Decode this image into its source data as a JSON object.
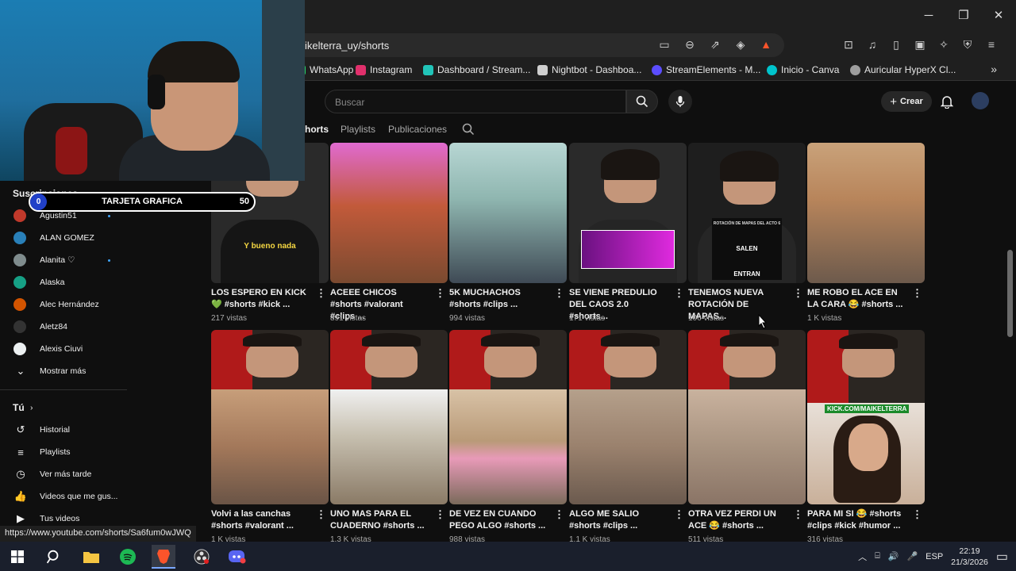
{
  "browser": {
    "url": "ikelterra_uy/shorts",
    "bookmarks": [
      {
        "label": "WhatsApp",
        "color": "#25d366"
      },
      {
        "label": "Instagram",
        "color": "#e1306c"
      },
      {
        "label": "Dashboard / Stream...",
        "color": "#21c4b8"
      },
      {
        "label": "Nightbot - Dashboa...",
        "color": "#cfcfcf"
      },
      {
        "label": "StreamElements - M...",
        "color": "#5b4dff"
      },
      {
        "label": "Inicio - Canva",
        "color": "#00c4cc"
      },
      {
        "label": "Auricular HyperX Cl...",
        "color": "#9e9e9e"
      }
    ],
    "status_url": "https://www.youtube.com/shorts/Sa6fum0wJWQ"
  },
  "youtube": {
    "search_placeholder": "Buscar",
    "create_label": "Crear",
    "tabs": [
      "Shorts",
      "Playlists",
      "Publicaciones"
    ],
    "tabs_display": [
      "horts",
      "Playlists",
      "Publicaciones"
    ],
    "active_tab": "Shorts"
  },
  "overlay": {
    "goal_label": "TARJETA GRAFICA",
    "goal_min": "0",
    "goal_max": "50",
    "goal_progress": 0.0
  },
  "sidebar": {
    "subscriptions_header": "Suscripciones",
    "subscriptions": [
      {
        "label": "Agustin51",
        "color": "#c0392b",
        "new": true
      },
      {
        "label": "ALAN GOMEZ",
        "color": "#2980b9",
        "new": false
      },
      {
        "label": "Alanita ♡",
        "color": "#7f8c8d",
        "new": true
      },
      {
        "label": "Alaska",
        "color": "#16a085",
        "new": false
      },
      {
        "label": "Alec Hernández",
        "color": "#d35400",
        "new": false
      },
      {
        "label": "Aletz84",
        "color": "#333333",
        "new": false
      },
      {
        "label": "Alexis Ciuvi",
        "color": "#ecf0f1",
        "new": false
      }
    ],
    "show_more": "Mostrar más",
    "you_header": "Tú",
    "you_items": [
      {
        "label": "Historial",
        "icon": "history-icon",
        "glyph": "↺"
      },
      {
        "label": "Playlists",
        "icon": "playlists-icon",
        "glyph": "≡"
      },
      {
        "label": "Ver más tarde",
        "icon": "watch-later-icon",
        "glyph": "◷"
      },
      {
        "label": "Videos que me gus...",
        "icon": "thumbs-up-icon",
        "glyph": "👍"
      },
      {
        "label": "Tus videos",
        "icon": "your-videos-icon",
        "glyph": "▶"
      }
    ]
  },
  "shorts_row1": [
    {
      "title": "LOS ESPERO EN KICK 💚 #shorts #kick ...",
      "views": "217 vistas"
    },
    {
      "title": "ACEEE CHICOS #shorts #valorant #clips ...",
      "views": "891 vistas"
    },
    {
      "title": "5K MUCHACHOS #shorts #clips ...",
      "views": "994 vistas"
    },
    {
      "title": "SE VIENE PREDULIO DEL CAOS 2.0 #shorts...",
      "views": "171 vistas"
    },
    {
      "title": "TENEMOS NUEVA ROTACIÓN DE MAPAS...",
      "views": "106 vistas"
    },
    {
      "title": "ME ROBO EL ACE EN LA CARA 😂 #shorts ...",
      "views": "1 K vistas"
    }
  ],
  "shorts_row2": [
    {
      "title": "Volvi a las canchas #shorts #valorant ...",
      "views": "1 K vistas"
    },
    {
      "title": "UNO MAS PARA EL CUADERNO #shorts ...",
      "views": "1,3 K vistas"
    },
    {
      "title": "DE VEZ EN CUANDO PEGO ALGO #shorts ...",
      "views": "988 vistas"
    },
    {
      "title": "ALGO ME SALIO #shorts #clips ...",
      "views": "1,1 K vistas"
    },
    {
      "title": "OTRA VEZ PERDI UN ACE 😂 #shorts ...",
      "views": "511 vistas"
    },
    {
      "title": "PARA MI SI 😂 #shorts #clips #kick #humor ...",
      "views": "316 vistas"
    }
  ],
  "thumb_texts": {
    "row1_0": "Y bueno nada",
    "row1_4_top": "ROTACIÓN DE MAPAS DEL ACTO 6",
    "row1_4_a": "SALEN",
    "row1_4_b": "ENTRAN",
    "row2_5": "KICK.COM/MAIKELTERRA"
  },
  "taskbar": {
    "language": "ESP",
    "time": "22:19",
    "date": "21/3/2026"
  }
}
